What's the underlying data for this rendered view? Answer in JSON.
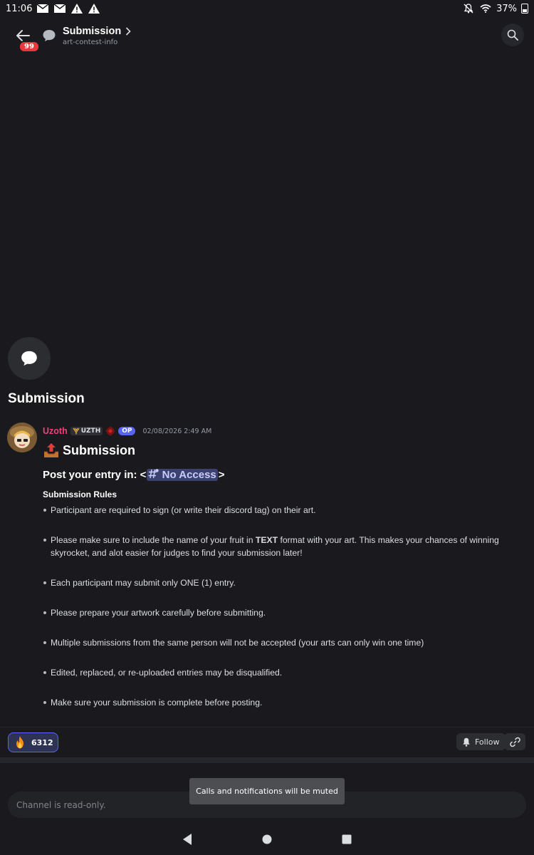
{
  "status_bar": {
    "time": "11:06",
    "left_icons": [
      "mail-icon",
      "mail-icon",
      "warning-icon",
      "warning-icon"
    ],
    "right_icons": [
      "notifications-off-icon",
      "wifi-icon"
    ],
    "battery": "37%"
  },
  "header": {
    "badge_count": "99",
    "title": "Submission",
    "subtitle": "art-contest-info"
  },
  "thread": {
    "title": "Submission"
  },
  "message": {
    "username": "Uzoth",
    "username_color": "#f23f7a",
    "tag_label": "UZTH",
    "op_label": "OP",
    "timestamp": "02/08/2026 2:49 AM",
    "heading": "Submission",
    "post_prefix": "Post your entry in: <",
    "channel_mention": "No Access",
    "post_suffix": ">",
    "rules_title": "Submission Rules",
    "rules": [
      {
        "text": "Participant are required to sign (or write their discord tag) on their art."
      },
      {
        "before": "Please make sure to include the name of your fruit in ",
        "bold": "TEXT",
        "after": " format with your art. This makes your chances of winning skyrocket, and alot easier for judges to find your submission later!"
      },
      {
        "text": "Each participant may submit only ONE (1) entry."
      },
      {
        "text": "Please prepare your artwork carefully before submitting."
      },
      {
        "text": "Multiple submissions from the same person will not be accepted (your arts can only win one time)"
      },
      {
        "text": "Edited, replaced, or re-uploaded entries may be disqualified."
      },
      {
        "text": "Make sure your submission is complete before posting."
      }
    ]
  },
  "reaction": {
    "emoji": "fire-icon",
    "count": "6312"
  },
  "actions": {
    "follow_label": "Follow"
  },
  "composer": {
    "placeholder": "Channel is read-only."
  },
  "toast": {
    "text": "Calls and notifications will be muted"
  },
  "colors": {
    "background": "#1a1a1e",
    "accent": "#5865f2",
    "badge": "#e5393b"
  }
}
